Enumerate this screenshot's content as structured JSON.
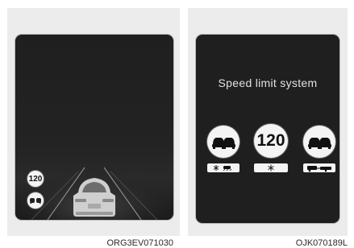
{
  "left_panel": {
    "caption": "ORG3EV071030",
    "cluster_speed_limit": "120",
    "icons": [
      "speed-limit-120-sign",
      "no-overtaking-sign",
      "leading-vehicle-rear-view"
    ]
  },
  "right_panel": {
    "caption": "OJK070189L",
    "title": "Speed limit system",
    "speed_limit": "120",
    "icons": [
      "no-overtaking-sign",
      "snowflake-icon",
      "wet-road-icon",
      "car-with-trailer-icon"
    ]
  },
  "colors": {
    "screen_bg": "#1f1f1f",
    "panel_bg": "#ececec",
    "sign_bg": "#f4f4f4"
  }
}
